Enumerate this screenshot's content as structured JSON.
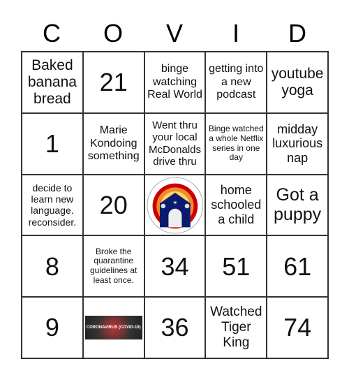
{
  "header": [
    "C",
    "O",
    "V",
    "I",
    "D"
  ],
  "cells": [
    [
      "Baked banana bread",
      "21",
      "binge watching Real World",
      "getting into a new podcast",
      "youtube yoga"
    ],
    [
      "1",
      "Marie Kondoing something",
      "Went thru your local McDonalds drive thru",
      "Binge watched a whole Netflix series in one day",
      "midday luxurious nap"
    ],
    [
      "decide to learn new language. reconsider.",
      "20",
      "",
      "home schooled a child",
      "Got a puppy"
    ],
    [
      "8",
      "Broke the quarantine guidelines at least once.",
      "34",
      "51",
      "61"
    ],
    [
      "9",
      "",
      "36",
      "Watched Tiger King",
      "74"
    ]
  ],
  "free_space": {
    "icon": "house-rainbow-star-logo"
  },
  "image_cell": {
    "caption": "CORONAVIRUS (COVID-19)"
  }
}
